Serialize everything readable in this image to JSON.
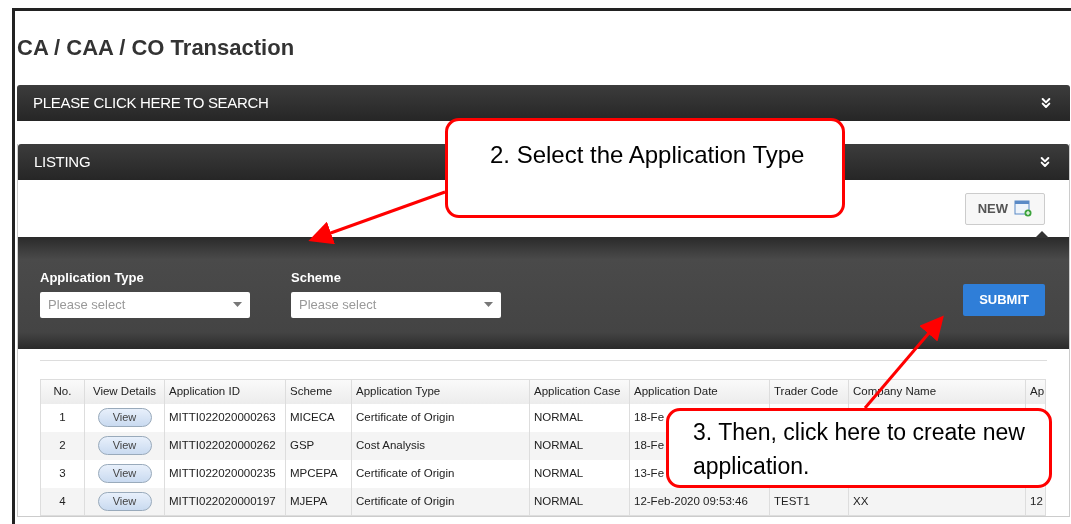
{
  "page_title": "CA / CAA / CO Transaction",
  "search_panel": {
    "label": "PLEASE CLICK HERE TO SEARCH"
  },
  "listing_panel": {
    "label": "LISTING"
  },
  "new_button": "NEW",
  "form": {
    "fields": [
      {
        "label": "Application Type",
        "placeholder": "Please select"
      },
      {
        "label": "Scheme",
        "placeholder": "Please select"
      }
    ],
    "submit": "SUBMIT"
  },
  "table": {
    "columns": [
      "No.",
      "View Details",
      "Application ID",
      "Scheme",
      "Application Type",
      "Application Case",
      "Application Date",
      "Trader Code",
      "Company Name",
      "Ap"
    ],
    "rows": [
      {
        "cells": [
          "1",
          "View",
          "MITTI022020000263",
          "MICECA",
          "Certificate of Origin",
          "NORMAL",
          "18-Fe",
          "",
          "",
          ""
        ]
      },
      {
        "cells": [
          "2",
          "View",
          "MITTI022020000262",
          "GSP",
          "Cost Analysis",
          "NORMAL",
          "18-Fe",
          "",
          "",
          ""
        ]
      },
      {
        "cells": [
          "3",
          "View",
          "MITTI022020000235",
          "MPCEPA",
          "Certificate of Origin",
          "NORMAL",
          "13-Fe",
          "",
          "",
          ""
        ]
      },
      {
        "cells": [
          "4",
          "View",
          "MITTI022020000197",
          "MJEPA",
          "Certificate of Origin",
          "NORMAL",
          "12-Feb-2020 09:53:46",
          "TEST1",
          "XX",
          "12"
        ]
      }
    ]
  },
  "callouts": [
    {
      "text": "2. Select the Application Type"
    },
    {
      "text": "3. Then, click here to create new application."
    }
  ]
}
